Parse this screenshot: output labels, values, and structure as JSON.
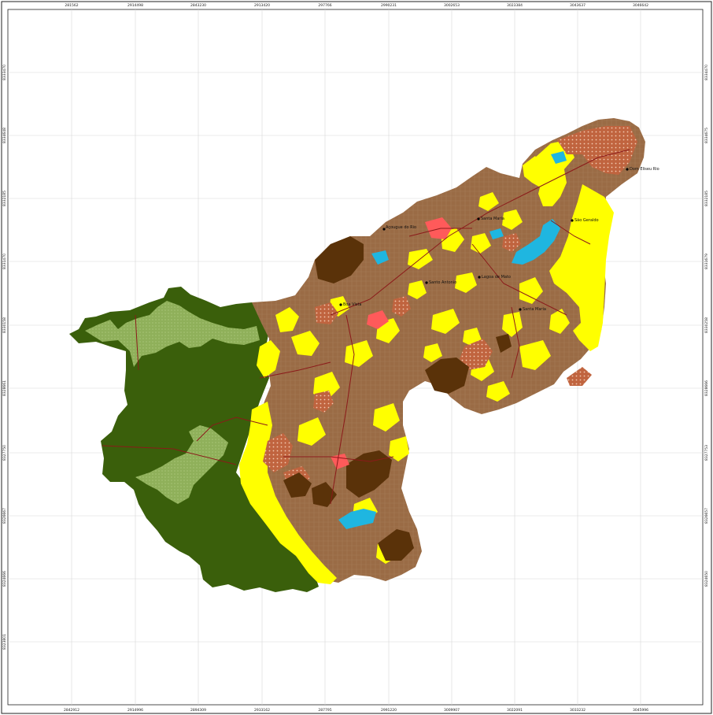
{
  "map": {
    "colors": {
      "pasture_brown": "#9a6b45",
      "dark_brown": "#5a3209",
      "yellow": "#ffff00",
      "dark_green": "#3a5f0b",
      "light_green": "#8fb05a",
      "water": "#1fb6e0",
      "urban": "#ff5a5a",
      "roads": "#8b1a1a",
      "grid": "#d7d7d7",
      "frame": "#222222"
    },
    "top_ticks": [
      "281562",
      "2914498",
      "2843230",
      "2913420",
      "297766",
      "2990231",
      "3002653",
      "3023384",
      "3043637",
      "3046642"
    ],
    "bottom_ticks": [
      "2842912",
      "2914996",
      "2894309",
      "2933162",
      "287795",
      "2991220",
      "3009907",
      "3022091",
      "3033232",
      "3045996"
    ],
    "left_ticks": [
      "8333470",
      "8334648",
      "8332185",
      "8331470",
      "8330158",
      "8328661",
      "8327750",
      "8326667",
      "8324666",
      "8323801"
    ],
    "right_ticks": [
      "8334470",
      "8334675",
      "8332185",
      "8331679",
      "8330258",
      "8328666",
      "8327753",
      "8326657",
      "8324650"
    ],
    "places": [
      {
        "label": "Dom Eliseu Rio"
      },
      {
        "label": "São Geraldo"
      },
      {
        "label": "Santa Maria"
      },
      {
        "label": "Açougue do Rio"
      },
      {
        "label": "Lagoa de Mato"
      },
      {
        "label": "Santo Antonio"
      },
      {
        "label": "Santa Maria"
      },
      {
        "label": "Boa Vista"
      }
    ]
  }
}
